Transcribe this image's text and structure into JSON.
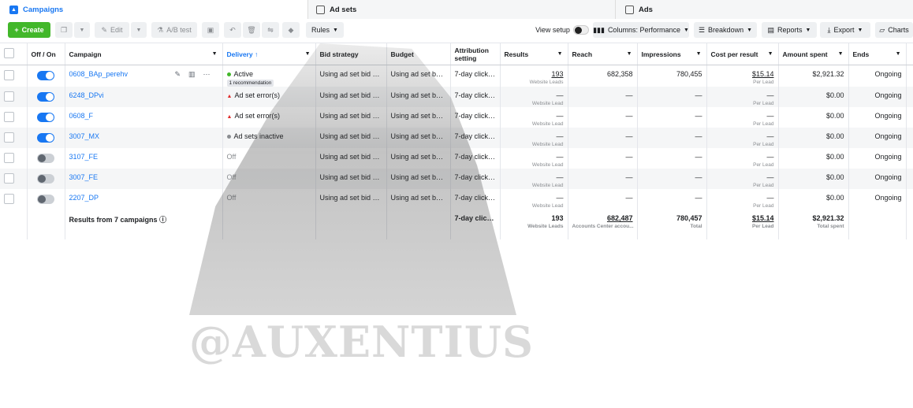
{
  "tabs": [
    {
      "label": "Campaigns",
      "icon": "campaign-icon"
    },
    {
      "label": "Ad sets",
      "icon": "grid-icon"
    },
    {
      "label": "Ads",
      "icon": "square-icon"
    }
  ],
  "toolbar": {
    "create": "Create",
    "edit": "Edit",
    "ab_test": "A/B test",
    "rules": "Rules",
    "view_setup": "View setup",
    "columns": "Columns: Performance",
    "breakdown": "Breakdown",
    "reports": "Reports",
    "export": "Export",
    "charts": "Charts"
  },
  "columns": {
    "offon": "Off / On",
    "campaign": "Campaign",
    "delivery": "Delivery ↑",
    "bid": "Bid strategy",
    "budget": "Budget",
    "attribution": "Attribution setting",
    "results": "Results",
    "reach": "Reach",
    "impressions": "Impressions",
    "cpr": "Cost per result",
    "spent": "Amount spent",
    "ends": "Ends"
  },
  "rows": [
    {
      "name": "0608_BAp_perehv",
      "delivery": "Active",
      "reco": "1 recommendation",
      "bid": "Using ad set bid stra...",
      "budget": "Using ad set budg...",
      "attr": "7-day click or 1...",
      "results": "193",
      "results_sub": "Website Leads",
      "reach": "682,358",
      "impr": "780,455",
      "cpr": "$15.14",
      "cpr_sub": "Per Lead",
      "spent": "$2,921.32",
      "ends": "Ongoing"
    },
    {
      "name": "6248_DPvi",
      "delivery": "Ad set error(s)",
      "reco": "",
      "bid": "Using ad set bid stra...",
      "budget": "Using ad set budg...",
      "attr": "7-day click or 1...",
      "results": "—",
      "results_sub": "Website Lead",
      "reach": "—",
      "impr": "—",
      "cpr": "—",
      "cpr_sub": "Per Lead",
      "spent": "$0.00",
      "ends": "Ongoing"
    },
    {
      "name": "0608_F",
      "delivery": "Ad set error(s)",
      "reco": "",
      "bid": "Using ad set bid stra...",
      "budget": "Using ad set budg...",
      "attr": "7-day click or 1...",
      "results": "—",
      "results_sub": "Website Lead",
      "reach": "—",
      "impr": "—",
      "cpr": "—",
      "cpr_sub": "Per Lead",
      "spent": "$0.00",
      "ends": "Ongoing"
    },
    {
      "name": "3007_MX",
      "delivery": "Ad sets inactive",
      "reco": "",
      "bid": "Using ad set bid stra...",
      "budget": "Using ad set budg...",
      "attr": "7-day click or 1...",
      "results": "—",
      "results_sub": "Website Lead",
      "reach": "—",
      "impr": "—",
      "cpr": "—",
      "cpr_sub": "Per Lead",
      "spent": "$0.00",
      "ends": "Ongoing"
    },
    {
      "name": "3107_FE",
      "delivery": "Off",
      "reco": "",
      "bid": "Using ad set bid stra...",
      "budget": "Using ad set budg...",
      "attr": "7-day click or 1...",
      "results": "—",
      "results_sub": "Website Lead",
      "reach": "—",
      "impr": "—",
      "cpr": "—",
      "cpr_sub": "Per Lead",
      "spent": "$0.00",
      "ends": "Ongoing"
    },
    {
      "name": "3007_FE",
      "delivery": "Off",
      "reco": "",
      "bid": "Using ad set bid stra...",
      "budget": "Using ad set budg...",
      "attr": "7-day click or 1...",
      "results": "—",
      "results_sub": "Website Lead",
      "reach": "—",
      "impr": "—",
      "cpr": "—",
      "cpr_sub": "Per Lead",
      "spent": "$0.00",
      "ends": "Ongoing"
    },
    {
      "name": "2207_DP",
      "delivery": "Off",
      "reco": "",
      "bid": "Using ad set bid stra...",
      "budget": "Using ad set budg...",
      "attr": "7-day click or 1...",
      "results": "—",
      "results_sub": "Website Lead",
      "reach": "—",
      "impr": "—",
      "cpr": "—",
      "cpr_sub": "Per Lead",
      "spent": "$0.00",
      "ends": "Ongoing"
    }
  ],
  "totals": {
    "label": "Results from 7 campaigns",
    "attr": "7-day click or ...",
    "results": "193",
    "results_sub": "Website Leads",
    "reach": "682,487",
    "reach_sub": "Accounts Center accou...",
    "impr": "780,457",
    "impr_sub": "Total",
    "cpr": "$15.14",
    "cpr_sub": "Per Lead",
    "spent": "$2,921.32",
    "spent_sub": "Total spent"
  },
  "watermark": "@AUXENTIUS",
  "colors": {
    "accent": "#1877f2",
    "create": "#42b72a",
    "error": "#e02b2b",
    "active": "#42b72a"
  }
}
